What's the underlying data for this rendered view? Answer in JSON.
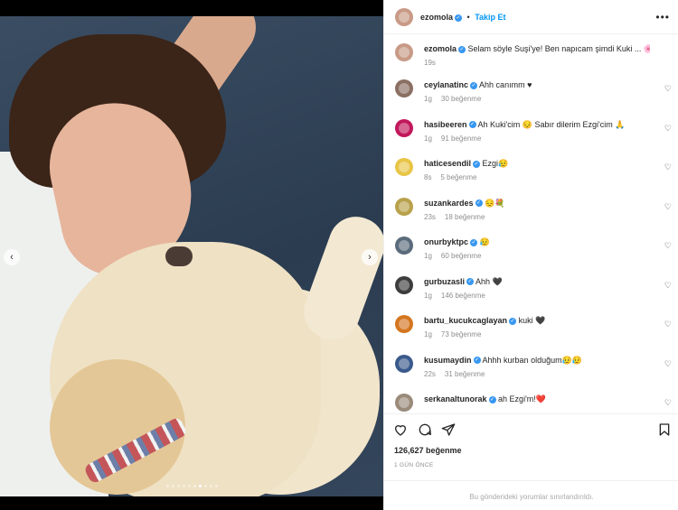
{
  "post": {
    "author": "ezomola",
    "follow_label": "Takip Et",
    "caption": "Selam söyle Suşi'ye! Ben napıcam şimdi Kuki ... 🌸",
    "caption_time": "19s",
    "likes": "126,627 beğenme",
    "posted_ago": "1 GÜN ÖNCE",
    "comments_limited": "Bu gönderideki yorumlar sınırlandırıldı."
  },
  "comments": [
    {
      "user": "ceylanatinc",
      "text": "Ahh canımm ♥",
      "time": "1g",
      "likes": "30 beğenme",
      "avatar_color": "#8a6f63"
    },
    {
      "user": "hasibeeren",
      "text": "Ah Kuki'cim 😔 Sabır dilerim Ezgi'cim 🙏",
      "time": "1g",
      "likes": "91 beğenme",
      "avatar_color": "#c2185b"
    },
    {
      "user": "haticesendil",
      "text": "Ezgi😥",
      "time": "8s",
      "likes": "5 beğenme",
      "avatar_color": "#e8c547"
    },
    {
      "user": "suzankardes",
      "text": "😔💐",
      "time": "23s",
      "likes": "18 beğenme",
      "avatar_color": "#b8a14a"
    },
    {
      "user": "onurbyktpc",
      "text": "😥",
      "time": "1g",
      "likes": "60 beğenme",
      "avatar_color": "#5a6b7c"
    },
    {
      "user": "gurbuzasli",
      "text": "Ahh 🖤",
      "time": "1g",
      "likes": "146 beğenme",
      "avatar_color": "#3d3d3d"
    },
    {
      "user": "bartu_kucukcaglayan",
      "text": "kuki 🖤",
      "time": "1g",
      "likes": "73 beğenme",
      "avatar_color": "#d4761f"
    },
    {
      "user": "kusumaydin",
      "text": "Ahhh kurban olduğum😥😥",
      "time": "22s",
      "likes": "31 beğenme",
      "avatar_color": "#3a5a8c"
    },
    {
      "user": "serkanaltunorak",
      "text": "ah Ezgi'm!❤️",
      "time": "",
      "likes": "",
      "avatar_color": "#9a8a7a"
    }
  ],
  "icons": {
    "like": "heart-icon",
    "comment": "comment-icon",
    "share": "paper-plane-icon",
    "save": "bookmark-icon",
    "more": "more-options-icon"
  },
  "carousel": {
    "count": 10,
    "active_index": 6
  },
  "colors": {
    "accent": "#0095f6",
    "verified": "#3897f0",
    "muted": "#8e8e8e"
  }
}
